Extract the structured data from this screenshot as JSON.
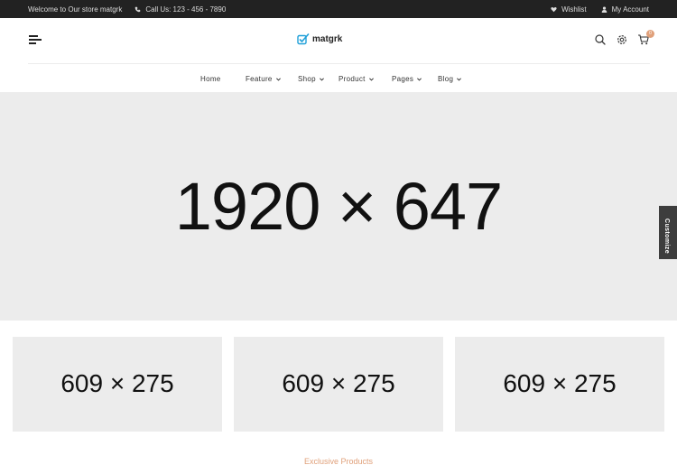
{
  "topbar": {
    "welcome": "Welcome to Our store matgrk",
    "phone": "Call Us: 123 - 456 - 7890",
    "wishlist": "Wishlist",
    "account": "My Account"
  },
  "header": {
    "logo": "matgrk",
    "cart_count": "0"
  },
  "nav": {
    "items": [
      {
        "label": "Home"
      },
      {
        "label": "Feature"
      },
      {
        "label": "Shop"
      },
      {
        "label": "Product"
      },
      {
        "label": "Pages"
      },
      {
        "label": "Blog"
      }
    ]
  },
  "hero": {
    "placeholder": "1920 × 647"
  },
  "banners": [
    {
      "placeholder": "609 × 275"
    },
    {
      "placeholder": "609 × 275"
    },
    {
      "placeholder": "609 × 275"
    }
  ],
  "customize": {
    "label": "Customize"
  },
  "section": {
    "title": "Exclusive Products"
  },
  "colors": {
    "accent": "#e0a07a",
    "topbar": "#222222",
    "placeholder_bg": "#ececec",
    "logo_icon": "#1e9fd8"
  }
}
